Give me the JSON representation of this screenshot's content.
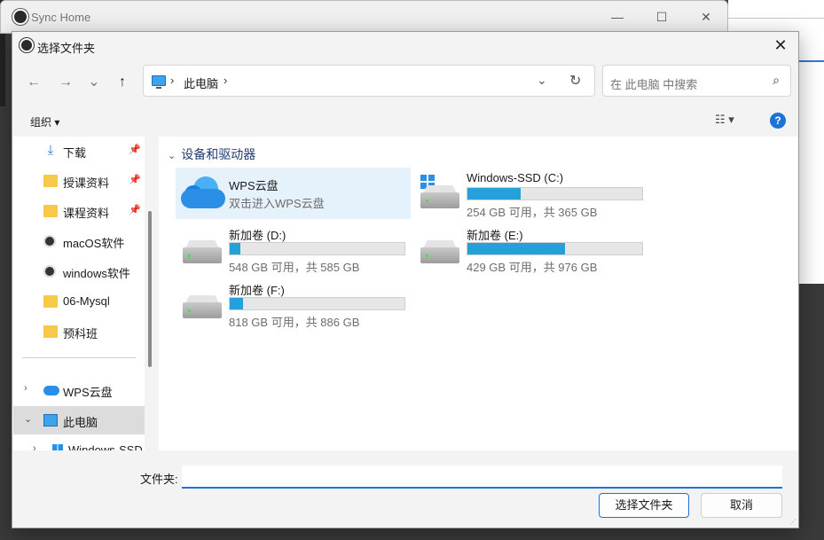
{
  "background_app": {
    "title": "Sync Home"
  },
  "dialog": {
    "title": "选择文件夹",
    "close_glyph": "✕"
  },
  "nav": {
    "back": "←",
    "forward": "→",
    "recent": "⌄",
    "up": "↑",
    "breadcrumb_sep": "›",
    "breadcrumb": "此电脑",
    "address_dropdown": "⌄",
    "refresh": "↻",
    "search_placeholder": "在 此电脑 中搜索",
    "search_glyph": "⌕"
  },
  "toolbar": {
    "organize": "组织 ▾",
    "view": "☷ ▾",
    "help": "?"
  },
  "sidebar": {
    "pin_glyph": "📌",
    "items": [
      {
        "label": "下载",
        "icon": "download-icon",
        "pinned": true
      },
      {
        "label": "授课资料",
        "icon": "folder-icon",
        "pinned": true
      },
      {
        "label": "课程资料",
        "icon": "folder-icon",
        "pinned": true
      },
      {
        "label": "macOS软件",
        "icon": "app-icon"
      },
      {
        "label": "windows软件",
        "icon": "app-icon"
      },
      {
        "label": "06-Mysql",
        "icon": "folder-icon"
      },
      {
        "label": "预科班",
        "icon": "folder-icon"
      }
    ],
    "tree": [
      {
        "label": "WPS云盘",
        "arrow": "›",
        "icon": "cloud-icon"
      },
      {
        "label": "此电脑",
        "arrow": "⌄",
        "icon": "computer-icon",
        "selected": true
      },
      {
        "label": "Windows-SSD",
        "arrow": "›",
        "icon": "windows-icon"
      }
    ]
  },
  "content": {
    "group_chevron": "⌄",
    "group_title": "设备和驱动器",
    "wps": {
      "name": "WPS云盘",
      "subtitle": "双击进入WPS云盘"
    },
    "drives": [
      {
        "name": "Windows-SSD (C:)",
        "info": "254 GB 可用，共 365 GB",
        "used_fraction": 0.304,
        "system": true
      },
      {
        "name": "新加卷 (D:)",
        "info": "548 GB 可用，共 585 GB",
        "used_fraction": 0.063
      },
      {
        "name": "新加卷 (E:)",
        "info": "429 GB 可用，共 976 GB",
        "used_fraction": 0.56
      },
      {
        "name": "新加卷 (F:)",
        "info": "818 GB 可用，共 886 GB",
        "used_fraction": 0.077
      }
    ]
  },
  "footer": {
    "folder_label": "文件夹:",
    "folder_value": "",
    "select_button": "选择文件夹",
    "cancel_button": "取消"
  },
  "colors": {
    "accent": "#1a74d8",
    "drive_bar": "#26a0da",
    "selected_bg": "#dcdcdc"
  }
}
